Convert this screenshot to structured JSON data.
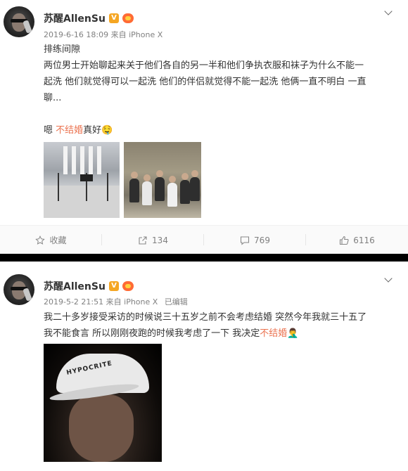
{
  "posts": [
    {
      "username": "苏醒AllenSu",
      "verified_badge": "V",
      "timestamp": "2019-6-16 18:09",
      "source": "来自 iPhone X",
      "edited": "",
      "line1": "排练间隙",
      "line2": "两位男士开始聊起来关于他们各自的另一半和他们争执衣服和袜子为什么不能一",
      "line3": "起洗 他们就觉得可以一起洗 他们的伴侣就觉得不能一起洗 他俩一直不明白 一直",
      "line4": "聊...",
      "line5_prefix": "嗯 ",
      "line5_red": "不结婚",
      "line5_suffix": "真好",
      "emoji": "🤤",
      "actions": {
        "collect_label": "收藏",
        "share_count": "134",
        "comment_count": "769",
        "like_count": "6116"
      }
    },
    {
      "username": "苏醒AllenSu",
      "verified_badge": "V",
      "timestamp": "2019-5-2 21:51",
      "source": "来自 iPhone X",
      "edited": "已编辑",
      "line1": "我二十多岁接受采访的时候说三十五岁之前不会考虑结婚 突然今年我就三十五了",
      "line2_prefix": "我不能食言 所以刚刚夜跑的时候我考虑了一下 我决定",
      "line2_red": "不结婚",
      "emoji": "🤦‍♂️",
      "image_text": "HYPOCRITE"
    }
  ],
  "colors": {
    "highlight": "#eb7350",
    "meta": "#808080",
    "separator": "#000000",
    "action_bar": "#fafafa"
  },
  "icons": [
    "chevron-down-icon",
    "star-icon",
    "share-icon",
    "comment-icon",
    "like-icon"
  ]
}
